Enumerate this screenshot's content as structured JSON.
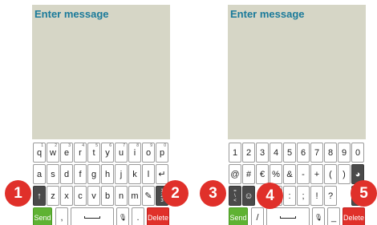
{
  "left": {
    "title": "Enter message",
    "row1": [
      {
        "label": "q",
        "sup": "1"
      },
      {
        "label": "w",
        "sup": "2"
      },
      {
        "label": "e",
        "sup": "3"
      },
      {
        "label": "r",
        "sup": "4"
      },
      {
        "label": "t",
        "sup": "5"
      },
      {
        "label": "y",
        "sup": "6"
      },
      {
        "label": "u",
        "sup": "7"
      },
      {
        "label": "i",
        "sup": "8"
      },
      {
        "label": "o",
        "sup": "9"
      },
      {
        "label": "p",
        "sup": "0"
      }
    ],
    "row2": [
      "a",
      "s",
      "d",
      "f",
      "g",
      "h",
      "j",
      "k",
      "l",
      "↵"
    ],
    "row3": {
      "shift": "↑",
      "letters": [
        "z",
        "x",
        "c",
        "v",
        "b",
        "n",
        "m"
      ],
      "special": "✎",
      "numbers": [
        "1",
        "2",
        "3"
      ]
    },
    "row4": {
      "send": "Send",
      "comma": ",",
      "mic": "🎙",
      "period": ".",
      "delete": "Delete"
    }
  },
  "right": {
    "title": "Enter message",
    "row1": [
      "1",
      "2",
      "3",
      "4",
      "5",
      "6",
      "7",
      "8",
      "9",
      "0"
    ],
    "row2": [
      "@",
      "#",
      "€",
      "%",
      "&",
      "-",
      "+",
      "(",
      ")",
      "◕"
    ],
    "row3": {
      "sym": [
        "=",
        "\\",
        "<"
      ],
      "emoji": "☺",
      "keys": [
        "'",
        ":",
        ";",
        "!",
        "?"
      ],
      "abc": [
        "A",
        "B",
        "C"
      ]
    },
    "row4": {
      "send": "Send",
      "slash": "/",
      "mic": "🎙",
      "underscore": "_",
      "delete": "Delete"
    }
  },
  "badges": [
    "1",
    "2",
    "3",
    "4",
    "5"
  ],
  "colors": {
    "accent_title": "#1a7a9a",
    "send": "#5fb233",
    "delete": "#e0302a",
    "badge": "#e0302a",
    "screen": "#d6d6c6"
  }
}
